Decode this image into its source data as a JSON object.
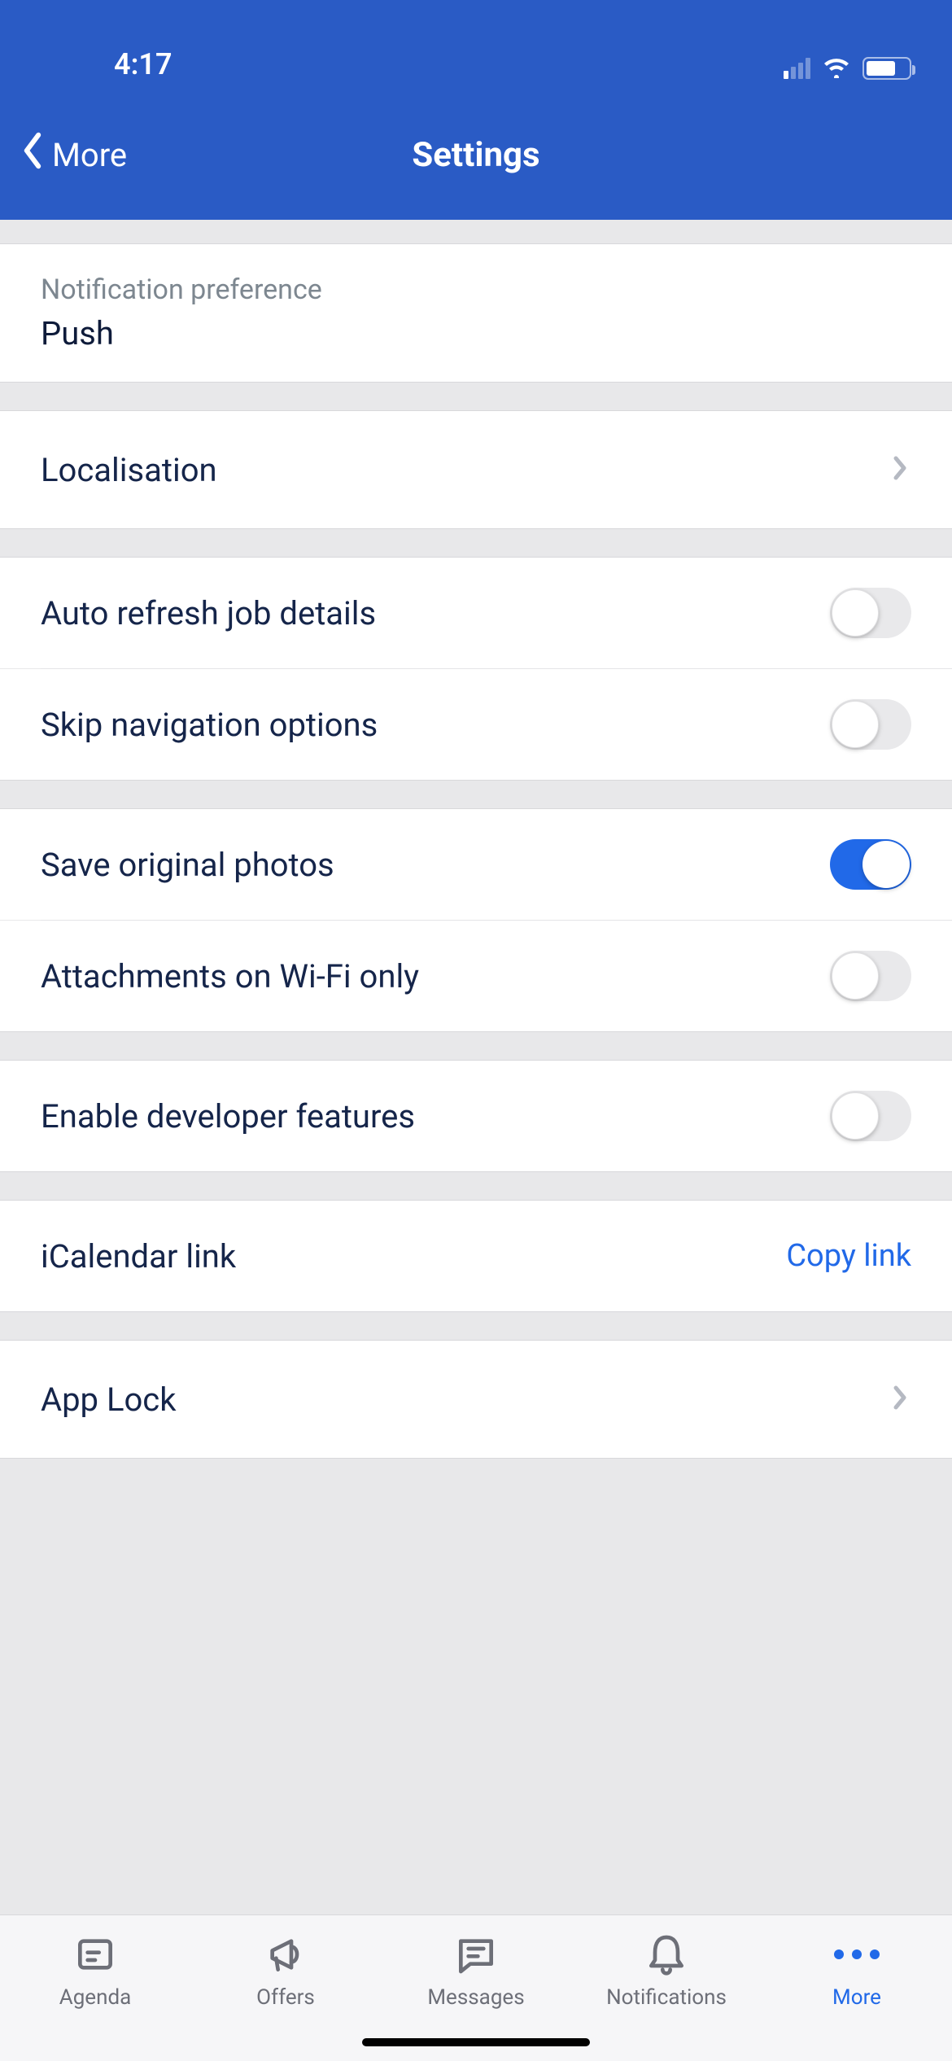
{
  "status": {
    "time": "4:17"
  },
  "nav": {
    "back_label": "More",
    "title": "Settings"
  },
  "notification_pref": {
    "label": "Notification preference",
    "value": "Push"
  },
  "localisation": {
    "label": "Localisation"
  },
  "toggles": {
    "auto_refresh": {
      "label": "Auto refresh job details",
      "on": false
    },
    "skip_nav": {
      "label": "Skip navigation options",
      "on": false
    },
    "save_photos": {
      "label": "Save original photos",
      "on": true
    },
    "wifi_attach": {
      "label": "Attachments on Wi-Fi only",
      "on": false
    },
    "dev_features": {
      "label": "Enable developer features",
      "on": false
    }
  },
  "ical": {
    "label": "iCalendar link",
    "action": "Copy link"
  },
  "app_lock": {
    "label": "App Lock"
  },
  "tabs": {
    "agenda": "Agenda",
    "offers": "Offers",
    "messages": "Messages",
    "notifications": "Notifications",
    "more": "More"
  }
}
